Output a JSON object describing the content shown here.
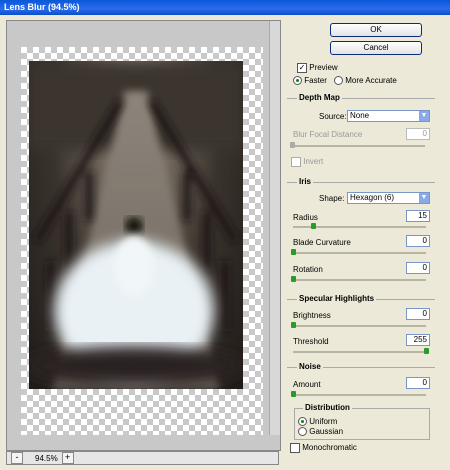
{
  "window": {
    "title": "Lens Blur (94.5%)"
  },
  "buttons": {
    "ok": "OK",
    "cancel": "Cancel"
  },
  "preview": {
    "label": "Preview",
    "faster": "Faster",
    "more_accurate": "More Accurate"
  },
  "depth_map": {
    "title": "Depth Map",
    "source_label": "Source:",
    "source_value": "None",
    "blur_focal_label": "Blur Focal Distance",
    "blur_focal_value": "0",
    "invert_label": "Invert"
  },
  "iris": {
    "title": "Iris",
    "shape_label": "Shape:",
    "shape_value": "Hexagon (6)",
    "radius_label": "Radius",
    "radius_value": "15",
    "blade_label": "Blade Curvature",
    "blade_value": "0",
    "rotation_label": "Rotation",
    "rotation_value": "0"
  },
  "specular": {
    "title": "Specular Highlights",
    "brightness_label": "Brightness",
    "brightness_value": "0",
    "threshold_label": "Threshold",
    "threshold_value": "255"
  },
  "noise": {
    "title": "Noise",
    "amount_label": "Amount",
    "amount_value": "0",
    "distribution_title": "Distribution",
    "uniform": "Uniform",
    "gaussian": "Gaussian",
    "monochromatic": "Monochromatic"
  },
  "zoom": {
    "minus": "-",
    "plus": "+",
    "value": "94.5%"
  },
  "slider_levels": {
    "blur_focal": 0.0,
    "radius": 0.15,
    "blade": 0.0,
    "rotation": 0.0,
    "brightness": 0.0,
    "threshold": 1.0,
    "amount": 0.0
  }
}
